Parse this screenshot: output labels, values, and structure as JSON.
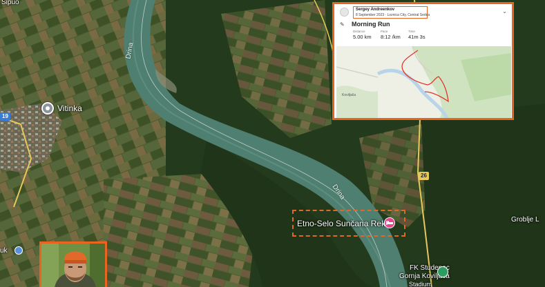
{
  "map": {
    "labels": {
      "sipuo": "Šipuo",
      "vitinka": "Vitinka",
      "road_19": "19",
      "river_upper": "Drina",
      "river_lower": "Drina",
      "road_26": "26",
      "groblje": "Groblje L",
      "uk": "uk",
      "hotel": "Etno-Selo Sunčana Reka",
      "fk_line1": "FK Studenac",
      "fk_line2": "Gornja Koviljača",
      "fk_line3": "Stadium"
    },
    "colors": {
      "river": "#4f7f70",
      "forest": "#243a1d",
      "field": "#5d6a3d",
      "highlight": "#e8651f",
      "hotel_pin": "#e5458c"
    }
  },
  "strava": {
    "athlete_name": "Sergey Andreenkov",
    "date_location": "8 September 2023 · Loznica City, Central Serbia",
    "activity_title": "Morning Run",
    "stats": [
      {
        "label": "Distance",
        "value": "5.00 km"
      },
      {
        "label": "Pace",
        "value": "8:12 /km"
      },
      {
        "label": "Time",
        "value": "41m 3s"
      }
    ],
    "map_town": "Koviljača",
    "route_color": "#e0352b"
  }
}
